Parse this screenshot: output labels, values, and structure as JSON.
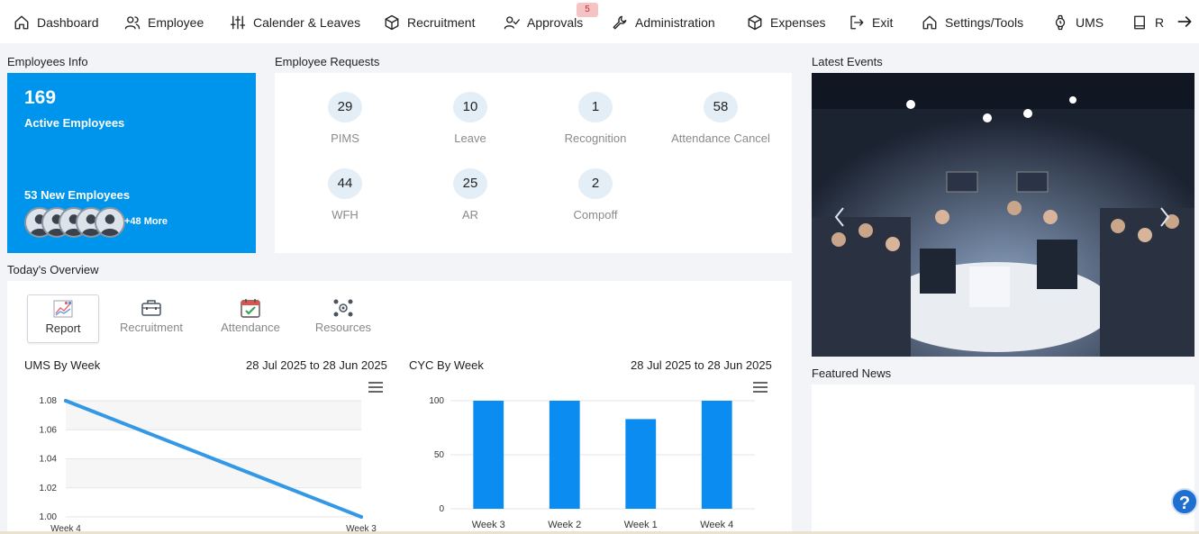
{
  "nav": {
    "items": [
      {
        "label": "Dashboard",
        "icon": "home-icon"
      },
      {
        "label": "Employee",
        "icon": "users-icon"
      },
      {
        "label": "Calender & Leaves",
        "icon": "sliders-icon"
      },
      {
        "label": "Recruitment",
        "icon": "cube-icon"
      },
      {
        "label": "Approvals",
        "icon": "user-check-icon"
      },
      {
        "label": "Administration",
        "icon": "wrench-icon"
      },
      {
        "label": "Expenses",
        "icon": "cube-icon"
      },
      {
        "label": "Exit",
        "icon": "exit-icon"
      },
      {
        "label": "Settings/Tools",
        "icon": "home-icon"
      },
      {
        "label": "UMS",
        "icon": "watch-icon"
      },
      {
        "label": "Re",
        "icon": "book-icon"
      }
    ],
    "approvals_badge": "5"
  },
  "employees_info": {
    "title": "Employees Info",
    "count": "169",
    "active_label": "Active Employees",
    "new_label": "53 New Employees",
    "more_label": "+48 More",
    "card_color": "#0095ec"
  },
  "employee_requests": {
    "title": "Employee Requests",
    "items": [
      {
        "value": "29",
        "label": "PIMS"
      },
      {
        "value": "10",
        "label": "Leave"
      },
      {
        "value": "1",
        "label": "Recognition"
      },
      {
        "value": "58",
        "label": "Attendance Cancel"
      },
      {
        "value": "44",
        "label": "WFH"
      },
      {
        "value": "25",
        "label": "AR"
      },
      {
        "value": "2",
        "label": "Compoff"
      }
    ]
  },
  "overview": {
    "title": "Today's Overview",
    "tabs": [
      {
        "label": "Report",
        "icon": "report-chart-icon",
        "active": true
      },
      {
        "label": "Recruitment",
        "icon": "briefcase-icon",
        "active": false
      },
      {
        "label": "Attendance",
        "icon": "calendar-check-icon",
        "active": false
      },
      {
        "label": "Resources",
        "icon": "resources-network-icon",
        "active": false
      }
    ]
  },
  "chart_data": [
    {
      "type": "line",
      "title": "UMS By Week",
      "range_label": "28 Jul 2025 to 28 Jun 2025",
      "x": [
        "Week 4",
        "Week 3"
      ],
      "series": [
        {
          "values": [
            1.08,
            1.0
          ]
        }
      ],
      "yticks": [
        "1.08",
        "1.06",
        "1.04",
        "1.02",
        "1.00"
      ],
      "ylim": [
        1.0,
        1.08
      ],
      "color": "#3399e6"
    },
    {
      "type": "bar",
      "title": "CYC By Week",
      "range_label": "28 Jul 2025 to 28 Jun 2025",
      "categories": [
        "Week 3",
        "Week 2",
        "Week 1",
        "Week 4"
      ],
      "values": [
        100,
        100,
        83,
        100
      ],
      "yticks": [
        "100",
        "50",
        "0"
      ],
      "ylim": [
        0,
        100
      ],
      "color": "#0a8cf0"
    }
  ],
  "right": {
    "events_title": "Latest Events",
    "news_title": "Featured News"
  },
  "help": {
    "label": "?"
  }
}
